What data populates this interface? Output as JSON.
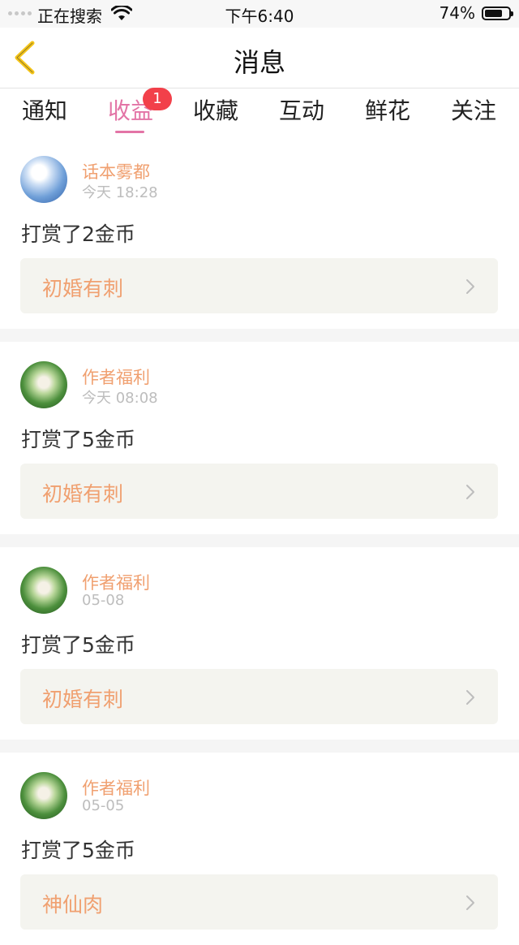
{
  "status_bar": {
    "carrier": "正在搜索",
    "time": "下午6:40",
    "battery_percent_text": "74%",
    "battery_level": 0.74
  },
  "nav": {
    "title": "消息",
    "back_icon": "chevron-left-icon",
    "back_color": "#f5c518"
  },
  "tabs": [
    {
      "label": "通知"
    },
    {
      "label": "收益",
      "badge": "1",
      "active": true
    },
    {
      "label": "收藏"
    },
    {
      "label": "互动"
    },
    {
      "label": "鲜花"
    },
    {
      "label": "关注"
    }
  ],
  "colors": {
    "accent": "#e374a6",
    "badge": "#f2404a",
    "sender": "#f0a070"
  },
  "messages": [
    {
      "sender": "话本雾都",
      "time": "今天 18:28",
      "text": "打赏了2金币",
      "book": "初婚有刺",
      "avatar": "blue"
    },
    {
      "sender": "作者福利",
      "time": "今天 08:08",
      "text": "打赏了5金币",
      "book": "初婚有刺",
      "avatar": "green"
    },
    {
      "sender": "作者福利",
      "time": "05-08",
      "text": "打赏了5金币",
      "book": "初婚有刺",
      "avatar": "green"
    },
    {
      "sender": "作者福利",
      "time": "05-05",
      "text": "打赏了5金币",
      "book": "神仙肉",
      "avatar": "green"
    }
  ]
}
